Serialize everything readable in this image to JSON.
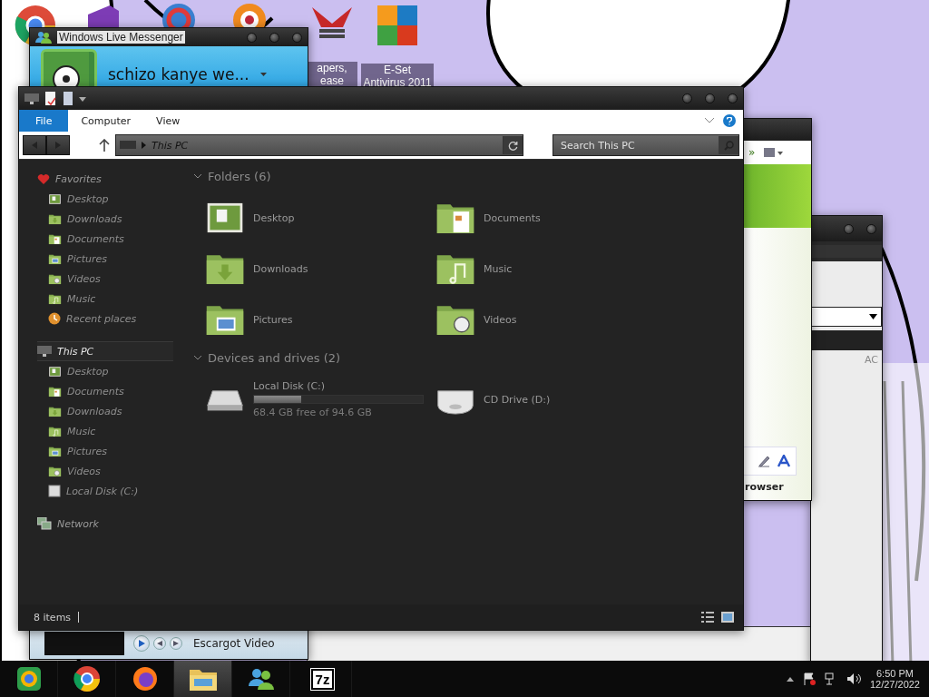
{
  "desktop": {
    "icons": [
      {
        "kind": "chrome"
      },
      {
        "kind": "studio"
      },
      {
        "kind": "ring"
      },
      {
        "kind": "orange"
      },
      {
        "kind": "eagle",
        "label": "apers, ease"
      },
      {
        "kind": "squares",
        "label": "E-Set Antivirus 2011"
      }
    ]
  },
  "messenger": {
    "title": "Windows Live Messenger",
    "user": "schizo kanye we...",
    "media": "Escargot Video"
  },
  "green_window": {
    "overflow": "»",
    "footer": "rowser"
  },
  "grey_window": {
    "column": "AC"
  },
  "explorer": {
    "tabs": [
      {
        "label": "File",
        "selected": true
      },
      {
        "label": "Computer",
        "selected": false
      },
      {
        "label": "View",
        "selected": false
      }
    ],
    "address": "This PC",
    "search": {
      "placeholder": "Search This PC"
    },
    "sidebar": [
      {
        "label": "Favorites",
        "kind": "heart",
        "selected": false,
        "children": [
          {
            "label": "Desktop",
            "kind": "desktop"
          },
          {
            "label": "Downloads",
            "kind": "downloads"
          },
          {
            "label": "Documents",
            "kind": "documents"
          },
          {
            "label": "Pictures",
            "kind": "pictures"
          },
          {
            "label": "Videos",
            "kind": "videos"
          },
          {
            "label": "Music",
            "kind": "music"
          },
          {
            "label": "Recent places",
            "kind": "recent"
          }
        ]
      },
      {
        "label": "This PC",
        "kind": "pc",
        "selected": true,
        "children": [
          {
            "label": "Desktop",
            "kind": "desktop"
          },
          {
            "label": "Documents",
            "kind": "documents"
          },
          {
            "label": "Downloads",
            "kind": "downloads"
          },
          {
            "label": "Music",
            "kind": "music"
          },
          {
            "label": "Pictures",
            "kind": "pictures"
          },
          {
            "label": "Videos",
            "kind": "videos"
          },
          {
            "label": "Local Disk (C:)",
            "kind": "disk"
          }
        ]
      },
      {
        "label": "Network",
        "kind": "network",
        "selected": false
      }
    ],
    "sections": [
      {
        "title": "Folders (6)",
        "expanded": true,
        "items": [
          {
            "label": "Desktop",
            "kind": "desktop"
          },
          {
            "label": "Documents",
            "kind": "documents"
          },
          {
            "label": "Downloads",
            "kind": "downloads"
          },
          {
            "label": "Music",
            "kind": "music"
          },
          {
            "label": "Pictures",
            "kind": "pictures"
          },
          {
            "label": "Videos",
            "kind": "videos"
          }
        ]
      },
      {
        "title": "Devices and drives (2)",
        "expanded": true,
        "items": [
          {
            "label": "Local Disk (C:)",
            "kind": "disk",
            "level": 0.28,
            "detail": "68.4 GB free of 94.6 GB"
          },
          {
            "label": "CD Drive (D:)",
            "kind": "cd"
          }
        ]
      }
    ],
    "status": "8 items"
  },
  "taskbar": {
    "items": [
      {
        "kind": "canary",
        "selected": false
      },
      {
        "kind": "chrome",
        "selected": false
      },
      {
        "kind": "firefox",
        "selected": false
      },
      {
        "kind": "explorer",
        "selected": true
      },
      {
        "kind": "messenger",
        "selected": false
      },
      {
        "kind": "zip",
        "label": "7z",
        "selected": false
      }
    ],
    "time": "6:50 PM",
    "date": "12/27/2022"
  }
}
